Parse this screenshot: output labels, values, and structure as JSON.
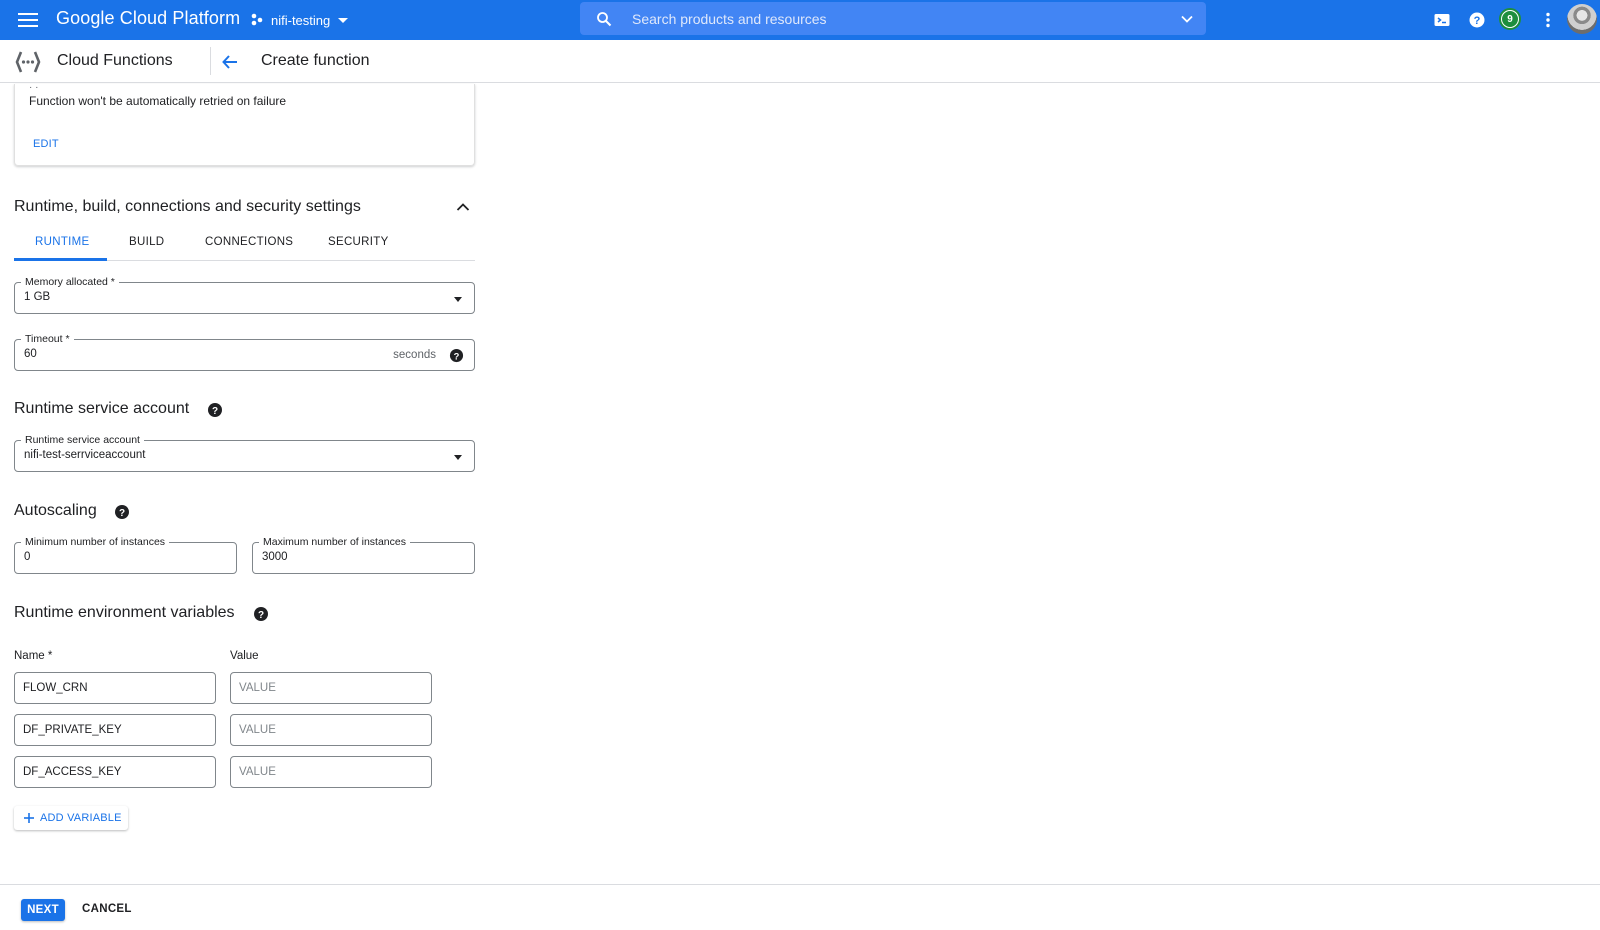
{
  "topbar": {
    "brand": "Google Cloud Platform",
    "project": "nifi-testing",
    "search_placeholder": "Search products and resources",
    "notification_count": "9",
    "icons": [
      "menu-icon",
      "project-icon",
      "search-icon",
      "chevron-down-icon",
      "cloud-shell-icon",
      "help-icon",
      "more-vert-icon",
      "account-avatar"
    ]
  },
  "subheader": {
    "product": "Cloud Functions",
    "page_title": "Create function"
  },
  "trigger_card": {
    "dots": "· ·",
    "retry_text": "Function won't be automatically retried on failure",
    "edit_label": "EDIT"
  },
  "settings": {
    "heading": "Runtime, build, connections and security settings",
    "tabs": [
      {
        "label": "RUNTIME",
        "active": true
      },
      {
        "label": "BUILD",
        "active": false
      },
      {
        "label": "CONNECTIONS",
        "active": false
      },
      {
        "label": "SECURITY",
        "active": false
      }
    ],
    "memory": {
      "label": "Memory allocated *",
      "value": "1 GB"
    },
    "timeout": {
      "label": "Timeout *",
      "value": "60",
      "suffix": "seconds"
    }
  },
  "service_account": {
    "heading": "Runtime service account",
    "field_label": "Runtime service account",
    "value": "nifi-test-serrviceaccount"
  },
  "autoscaling": {
    "heading": "Autoscaling",
    "min_label": "Minimum number of instances",
    "min_value": "0",
    "max_label": "Maximum number of instances",
    "max_value": "3000"
  },
  "env_vars": {
    "heading": "Runtime environment variables",
    "name_header": "Name *",
    "value_header": "Value",
    "rows": [
      {
        "name": "FLOW_CRN",
        "value_placeholder": "VALUE"
      },
      {
        "name": "DF_PRIVATE_KEY",
        "value_placeholder": "VALUE"
      },
      {
        "name": "DF_ACCESS_KEY",
        "value_placeholder": "VALUE"
      }
    ],
    "add_label": "ADD VARIABLE"
  },
  "footer": {
    "next_label": "NEXT",
    "cancel_label": "CANCEL"
  },
  "colors": {
    "primary": "#1a73e8",
    "search_bg": "#4285f4",
    "text": "#202124",
    "border": "#80868b",
    "badge": "#1e8e3e"
  }
}
